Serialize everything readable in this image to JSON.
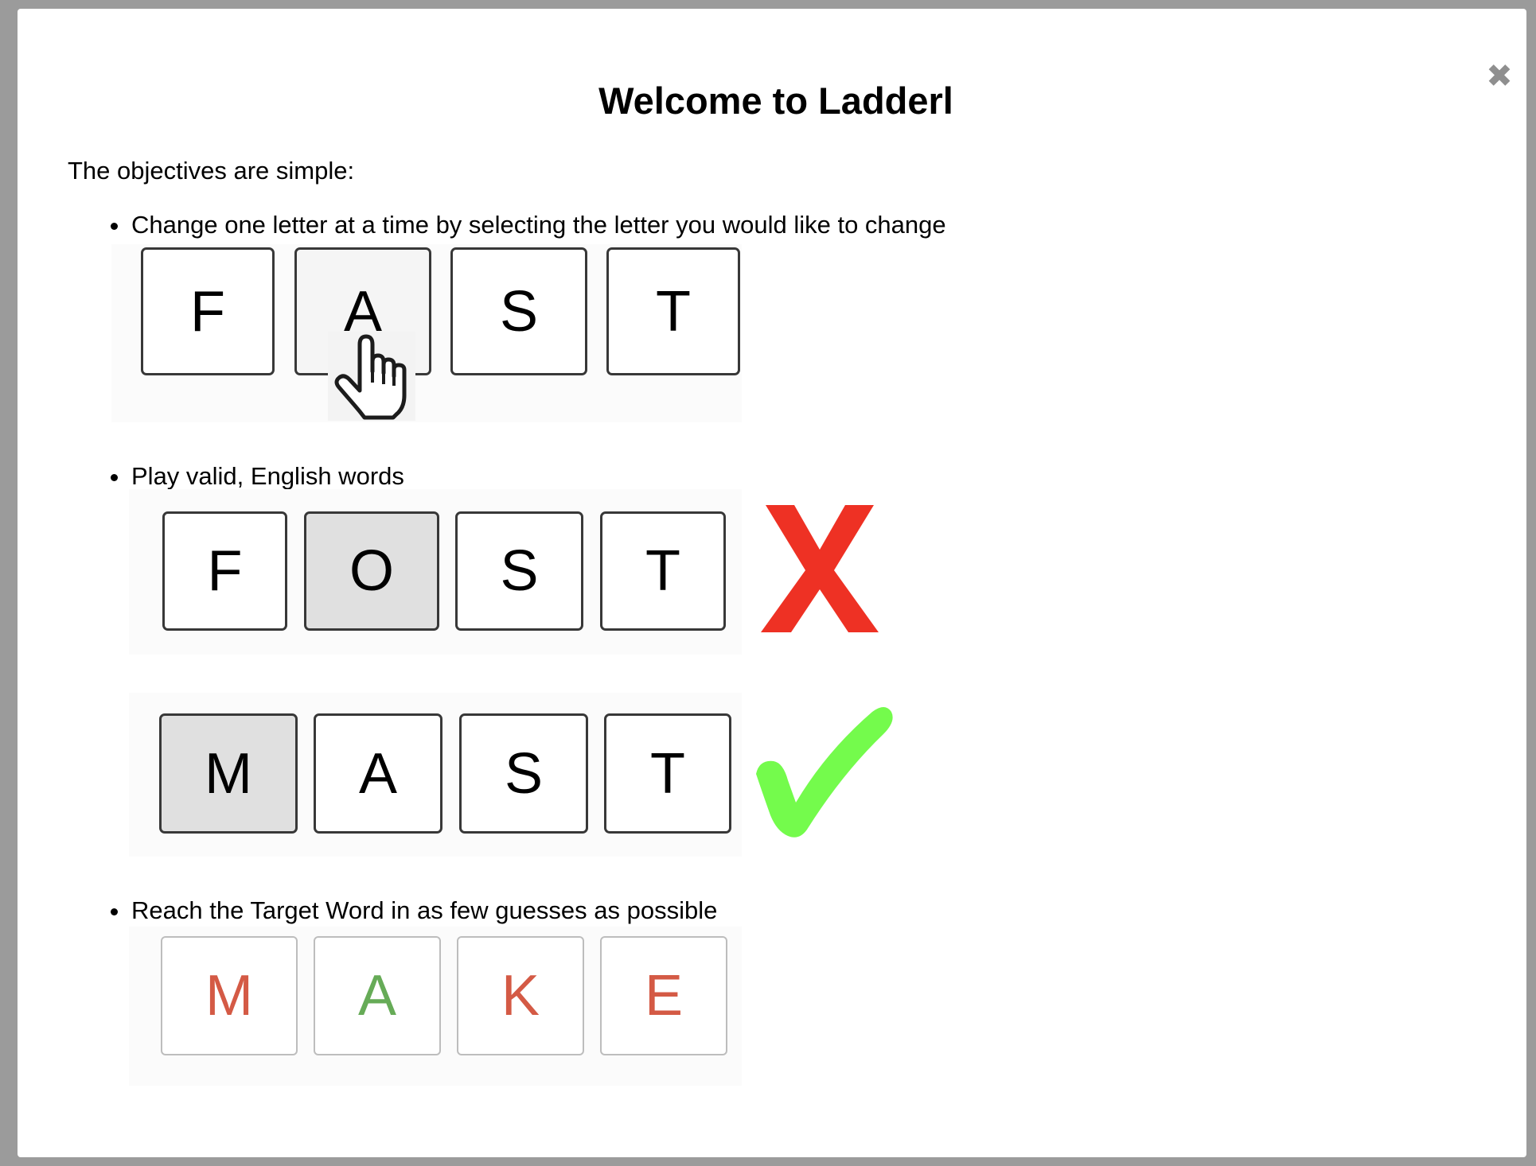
{
  "dialog": {
    "title": "Welcome to Ladderl",
    "close_icon": "close-icon",
    "intro": "The objectives are simple:"
  },
  "rules": [
    {
      "text": "Change one letter at a time by selecting the letter you would like to change"
    },
    {
      "text": "Play valid, English words"
    },
    {
      "text": "Reach the Target Word in as few guesses as possible"
    }
  ],
  "examples": {
    "select": {
      "letters": [
        "F",
        "A",
        "S",
        "T"
      ],
      "selected_index": 1,
      "cursor_icon": "hand-pointer-icon"
    },
    "invalid": {
      "letters": [
        "F",
        "O",
        "S",
        "T"
      ],
      "changed_index": 1,
      "result_icon": "red-x-icon",
      "result_color": "#ee3124"
    },
    "valid": {
      "letters": [
        "M",
        "A",
        "S",
        "T"
      ],
      "changed_index": 0,
      "result_icon": "green-check-icon",
      "result_color": "#74fb4c"
    },
    "target": {
      "letters": [
        "M",
        "A",
        "K",
        "E"
      ],
      "letter_colors": [
        "#d45a45",
        "#66ab57",
        "#d45a45",
        "#d45a45"
      ]
    }
  }
}
